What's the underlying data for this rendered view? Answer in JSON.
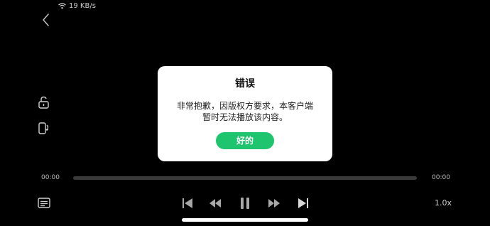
{
  "status_bar": {
    "network_speed": "19 KB/s",
    "wifi_icon": "wifi-icon"
  },
  "dialog": {
    "title": "错误",
    "message_line1": "非常抱歉，因版权方要求，本客户端",
    "message_line2": "暂时无法播放该内容。",
    "ok_label": "好的"
  },
  "player": {
    "current_time": "00:00",
    "total_time": "00:00",
    "progress": 0,
    "speed": "1.0x"
  },
  "icons": {
    "back": "back-icon",
    "lock": "unlock-icon",
    "rotate": "screen-rotate-icon",
    "subtitles": "subtitles-icon",
    "prev": "skip-previous-icon",
    "rewind": "rewind-icon",
    "pause": "pause-icon",
    "forward": "fast-forward-icon",
    "next": "skip-next-icon"
  },
  "colors": {
    "accent": "#1fc46e",
    "background": "#000000",
    "dialog_bg": "#ffffff"
  }
}
